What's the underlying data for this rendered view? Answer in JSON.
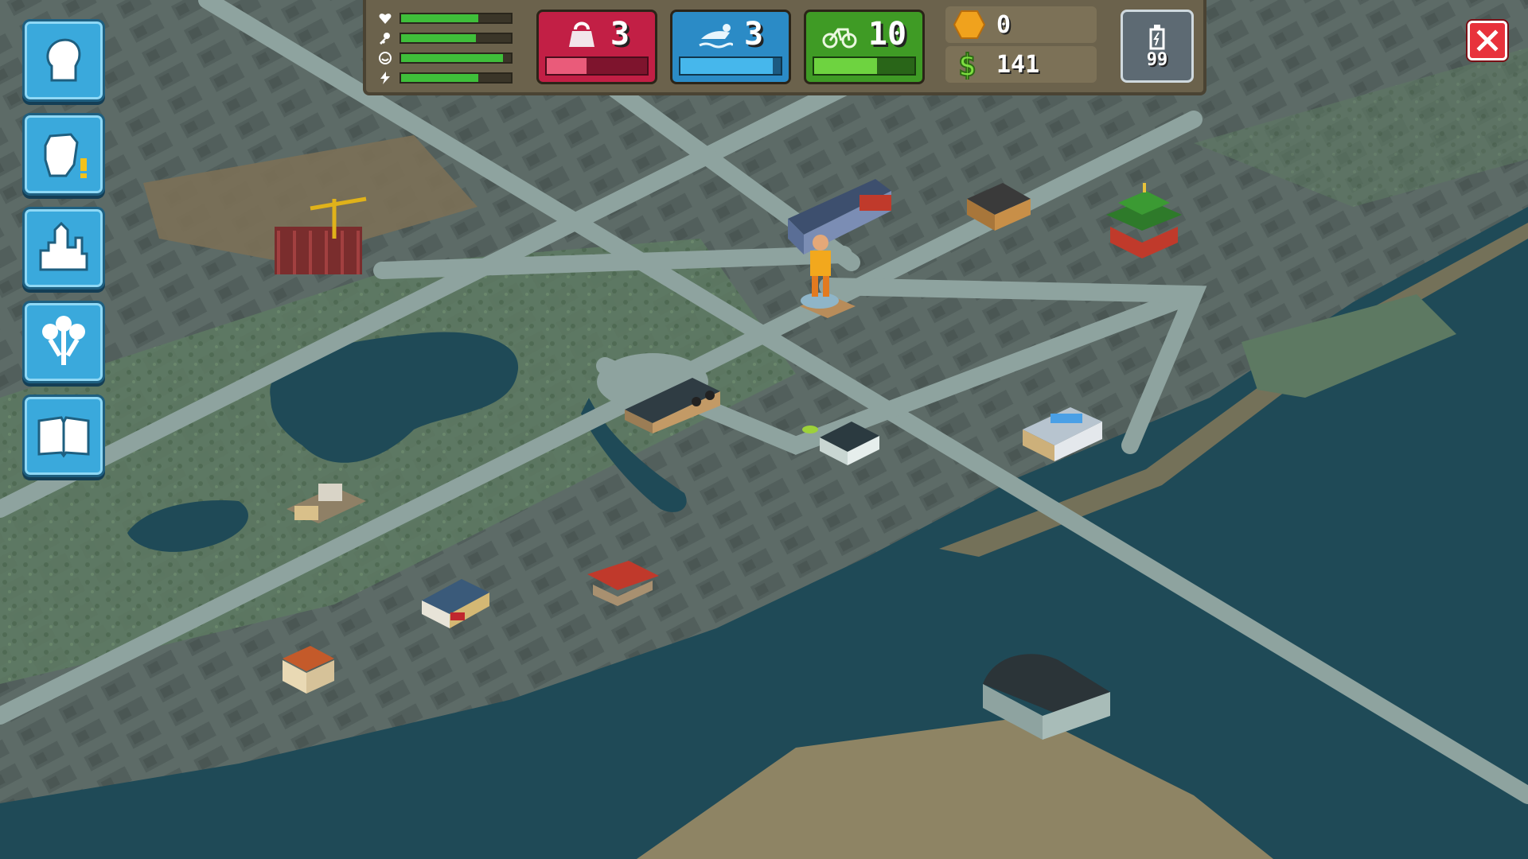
{
  "hud": {
    "vitals": [
      {
        "icon": "heart-icon",
        "level": 0.7
      },
      {
        "icon": "key-icon",
        "level": 0.68
      },
      {
        "icon": "smile-icon",
        "level": 0.93
      },
      {
        "icon": "lightning-icon",
        "level": 0.7
      }
    ],
    "stats": {
      "strength": {
        "icon": "kettlebell-icon",
        "value": "3",
        "progress": 0.4
      },
      "agility": {
        "icon": "swimmer-icon",
        "value": "3",
        "progress": 0.92
      },
      "endurance": {
        "icon": "bike-icon",
        "value": "10",
        "progress": 0.63
      }
    },
    "currency": {
      "coins": {
        "icon": "hexagon-coin-icon",
        "value": "0"
      },
      "money": {
        "icon": "dollar-icon",
        "value": "141"
      }
    },
    "energy": {
      "icon": "energy-drink-icon",
      "value": "99"
    }
  },
  "side_menu": [
    {
      "name": "character-button",
      "icon": "character-head-icon"
    },
    {
      "name": "fight-button",
      "icon": "fist-alert-icon"
    },
    {
      "name": "city-button",
      "icon": "city-skyline-icon"
    },
    {
      "name": "skills-tree-button",
      "icon": "tree-icon"
    },
    {
      "name": "journal-button",
      "icon": "open-book-icon"
    }
  ],
  "colors": {
    "water": "#1f4a57",
    "land": "#607066",
    "road": "#8ea39f",
    "park": "#567a5e",
    "sand": "#8a7a5a"
  }
}
